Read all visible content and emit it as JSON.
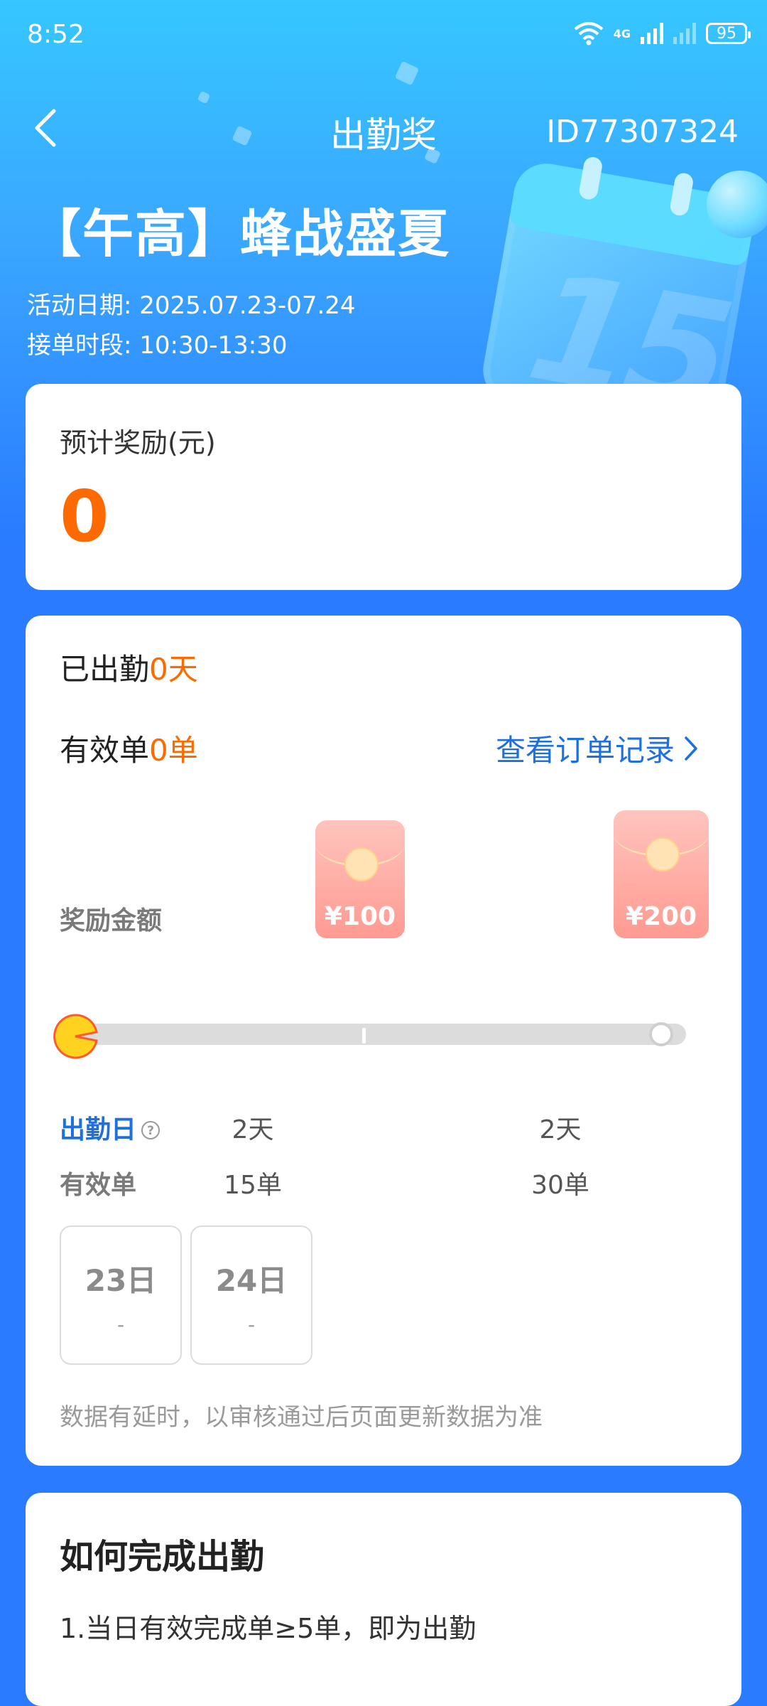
{
  "status_bar": {
    "time": "8:52",
    "network_label": "4G",
    "battery": "95"
  },
  "nav": {
    "title": "出勤奖",
    "id_text": "ID77307324"
  },
  "activity": {
    "title": "【午高】蜂战盛夏",
    "date": "活动日期: 2025.07.23-07.24",
    "time_slot": "接单时段: 10:30-13:30"
  },
  "reward_summary": {
    "label": "预计奖励(元)",
    "value": "0"
  },
  "progress": {
    "attendance_prefix": "已出勤",
    "attendance_value": "0天",
    "orders_prefix": "有效单",
    "orders_value": "0单",
    "view_orders_link": "查看订单记录",
    "reward_label": "奖励金额",
    "tiers": [
      {
        "amount": "¥100",
        "days": "2天",
        "orders": "15单"
      },
      {
        "amount": "¥200",
        "days": "2天",
        "orders": "30单"
      }
    ],
    "progress_fraction": 0,
    "row_labels": {
      "days": "出勤日",
      "orders": "有效单"
    },
    "day_boxes": [
      {
        "day": "23日",
        "value": "-"
      },
      {
        "day": "24日",
        "value": "-"
      }
    ],
    "notice": "数据有延时，以审核通过后页面更新数据为准"
  },
  "how_to": {
    "title": "如何完成出勤",
    "rule_1": "1.当日有效完成单≥5单，即为出勤"
  },
  "colors": {
    "accent_orange": "#ff6a00",
    "link_blue": "#1e6fe0",
    "hero_blue": "#2a7bff"
  }
}
